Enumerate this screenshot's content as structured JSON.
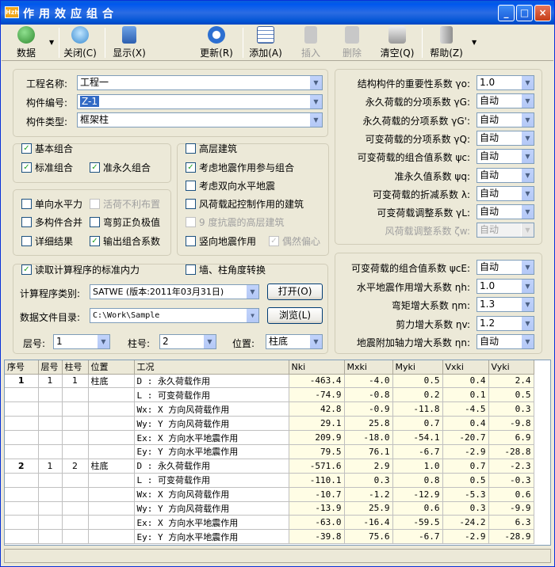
{
  "window": {
    "title": "作用效应组合",
    "icon": "Hzh",
    "min": "_",
    "max": "□",
    "close": "×"
  },
  "toolbar": {
    "data": "数据",
    "close": "关闭(C)",
    "show": "显示(X)",
    "update": "更新(R)",
    "add": "添加(A)",
    "insert": "插入",
    "delete": "删除",
    "clear": "清空(Q)",
    "help": "帮助(Z)"
  },
  "proj": {
    "name_label": "工程名称:",
    "name_value": "工程一",
    "member_id_label": "构件编号:",
    "member_id_value": "Z-1",
    "member_type_label": "构件类型:",
    "member_type_value": "框架柱"
  },
  "factors": [
    {
      "label": "结构构件的重要性系数 γo:",
      "value": "1.0",
      "enabled": true
    },
    {
      "label": "永久荷载的分项系数 γG:",
      "value": "自动",
      "enabled": true
    },
    {
      "label": "永久荷载的分项系数 γG':",
      "value": "自动",
      "enabled": true
    },
    {
      "label": "可变荷载的分项系数 γQ:",
      "value": "自动",
      "enabled": true
    },
    {
      "label": "可变荷载的组合值系数 ψc:",
      "value": "自动",
      "enabled": true
    },
    {
      "label": "准永久值系数 ψq:",
      "value": "自动",
      "enabled": true
    },
    {
      "label": "可变荷载的折减系数 λ:",
      "value": "自动",
      "enabled": true
    },
    {
      "label": "可变荷载调整系数 γL:",
      "value": "自动",
      "enabled": true
    },
    {
      "label": "风荷载调整系数 ζw:",
      "value": "自动",
      "enabled": false
    }
  ],
  "seismic_factors": [
    {
      "label": "可变荷载的组合值系数 ψcE:",
      "value": "自动"
    },
    {
      "label": "水平地震作用增大系数 ηh:",
      "value": "1.0"
    },
    {
      "label": "弯矩增大系数 ηm:",
      "value": "1.3"
    },
    {
      "label": "剪力增大系数 ηv:",
      "value": "1.2"
    },
    {
      "label": "地震附加轴力增大系数 ηn:",
      "value": "自动"
    }
  ],
  "options": {
    "basic": "基本组合",
    "standard": "标准组合",
    "quasi": "准永久组合",
    "uniaxial_wind": "单向水平力",
    "live_unfav": "活荷不利布置",
    "multi_merge": "多构件合并",
    "shear_moment": "弯剪正负极值",
    "detail": "详细结果",
    "output_coef": "输出组合系数",
    "high_rise": "高层建筑",
    "seismic_combo": "考虑地震作用参与组合",
    "bidir": "考虑双向水平地震",
    "wind_control": "风荷载起控制作用的建筑",
    "nine_degree": "9 度抗震的高层建筑",
    "vertical": "竖向地震作用",
    "accidental": "偶然偏心",
    "read_std": "读取计算程序的标准内力",
    "wall_angle": "墙、柱角度转换"
  },
  "calc": {
    "program_label": "计算程序类别:",
    "program_value": "SATWE (版本:2011年03月31日)",
    "open": "打开(O)",
    "dir_label": "数据文件目录:",
    "dir_value": "C:\\Work\\Sample",
    "browse": "浏览(L)",
    "floor_label": "层号:",
    "floor_value": "1",
    "col_label": "柱号:",
    "col_value": "2",
    "pos_label": "位置:",
    "pos_value": "柱底"
  },
  "table": {
    "headers": [
      "序号",
      "层号",
      "柱号",
      "位置",
      "工况",
      "Nki",
      "Mxki",
      "Myki",
      "Vxki",
      "Vyki"
    ],
    "groups": [
      {
        "seq": "1",
        "floor": "1",
        "col": "1",
        "pos": "柱底",
        "rows": [
          [
            "D : 永久荷载作用",
            "-463.4",
            "-4.0",
            "0.5",
            "0.4",
            "2.4"
          ],
          [
            "L : 可变荷载作用",
            "-74.9",
            "-0.8",
            "0.2",
            "0.1",
            "0.5"
          ],
          [
            "Wx: X 方向风荷载作用",
            "42.8",
            "-0.9",
            "-11.8",
            "-4.5",
            "0.3"
          ],
          [
            "Wy: Y 方向风荷载作用",
            "29.1",
            "25.8",
            "0.7",
            "0.4",
            "-9.8"
          ],
          [
            "Ex: X 方向水平地震作用",
            "209.9",
            "-18.0",
            "-54.1",
            "-20.7",
            "6.9"
          ],
          [
            "Ey: Y 方向水平地震作用",
            "79.5",
            "76.1",
            "-6.7",
            "-2.9",
            "-28.8"
          ]
        ]
      },
      {
        "seq": "2",
        "floor": "1",
        "col": "2",
        "pos": "柱底",
        "rows": [
          [
            "D : 永久荷载作用",
            "-571.6",
            "2.9",
            "1.0",
            "0.7",
            "-2.3"
          ],
          [
            "L : 可变荷载作用",
            "-110.1",
            "0.3",
            "0.8",
            "0.5",
            "-0.3"
          ],
          [
            "Wx: X 方向风荷载作用",
            "-10.7",
            "-1.2",
            "-12.9",
            "-5.3",
            "0.6"
          ],
          [
            "Wy: Y 方向风荷载作用",
            "-13.9",
            "25.9",
            "0.6",
            "0.3",
            "-9.9"
          ],
          [
            "Ex: X 方向水平地震作用",
            "-63.0",
            "-16.4",
            "-59.5",
            "-24.2",
            "6.3"
          ],
          [
            "Ey: Y 方向水平地震作用",
            "-39.8",
            "75.6",
            "-6.7",
            "-2.9",
            "-28.9"
          ]
        ]
      }
    ]
  }
}
